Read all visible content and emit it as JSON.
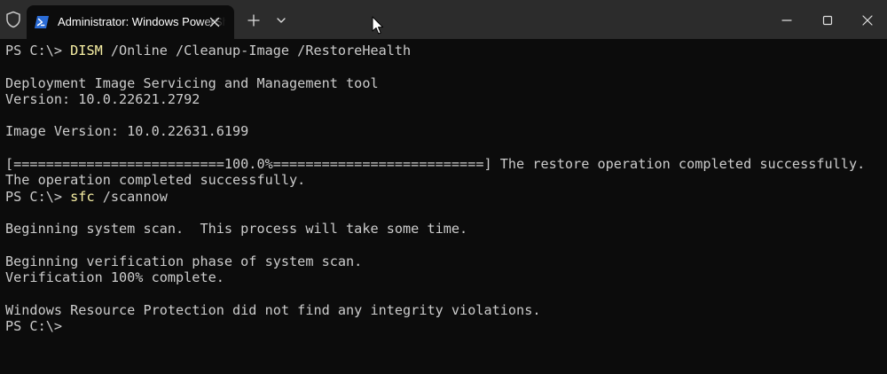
{
  "window": {
    "tab_title": "Administrator: Windows PowerShell",
    "icons": {
      "shield": "shield-icon",
      "tab": "powershell-icon",
      "tab_close": "close-icon",
      "new_tab": "plus-icon",
      "dropdown": "chevron-down-icon",
      "minimize": "minimize-icon",
      "maximize": "maximize-icon",
      "close": "close-icon",
      "pointer": "mouse-pointer-icon"
    }
  },
  "colors": {
    "background": "#0c0c0c",
    "titlebar": "#2c2c2c",
    "text": "#cccccc",
    "command": "#f9f1a5"
  },
  "terminal": {
    "lines": [
      {
        "prompt": "PS C:\\> ",
        "cmd": "DISM",
        "text": " /Online /Cleanup-Image /RestoreHealth"
      },
      {
        "text": ""
      },
      {
        "text": "Deployment Image Servicing and Management tool"
      },
      {
        "text": "Version: 10.0.22621.2792"
      },
      {
        "text": ""
      },
      {
        "text": "Image Version: 10.0.22631.6199"
      },
      {
        "text": ""
      },
      {
        "text": "[==========================100.0%==========================] The restore operation completed successfully."
      },
      {
        "text": "The operation completed successfully."
      },
      {
        "prompt": "PS C:\\> ",
        "cmd": "sfc",
        "text": " /scannow"
      },
      {
        "text": ""
      },
      {
        "text": "Beginning system scan.  This process will take some time."
      },
      {
        "text": ""
      },
      {
        "text": "Beginning verification phase of system scan."
      },
      {
        "text": "Verification 100% complete."
      },
      {
        "text": ""
      },
      {
        "text": "Windows Resource Protection did not find any integrity violations."
      },
      {
        "prompt": "PS C:\\>",
        "text": ""
      }
    ]
  }
}
